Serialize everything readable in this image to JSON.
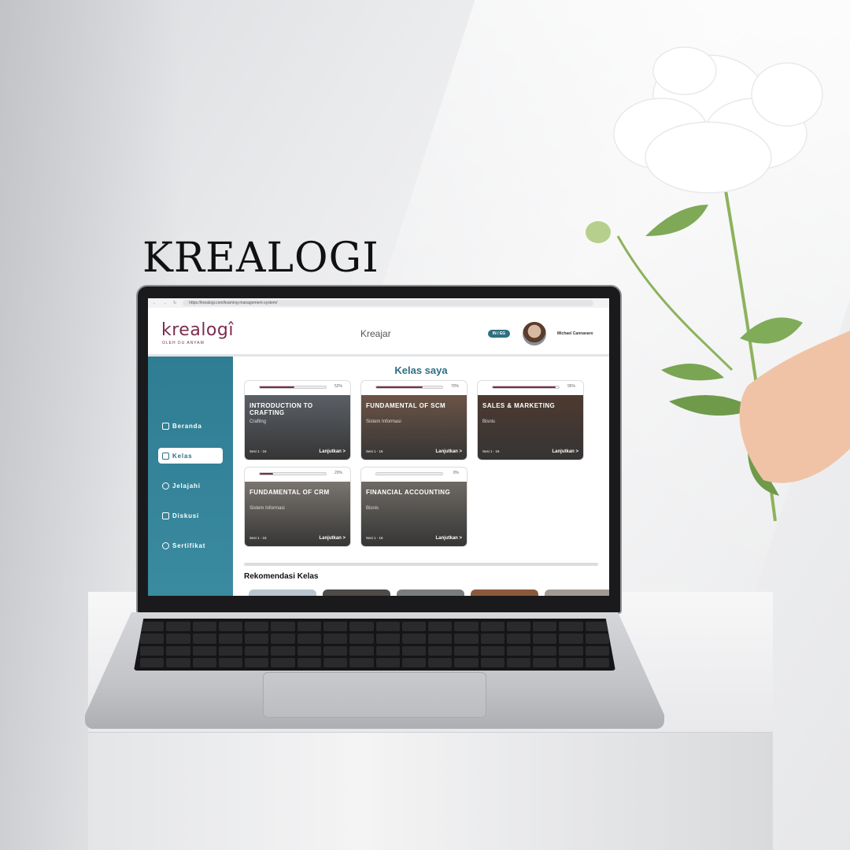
{
  "poster": {
    "brand": "KREALOGI"
  },
  "browser": {
    "url": "https://krealogi.com/learning-management-system/"
  },
  "header": {
    "logo_text": "krealogî",
    "logo_subtitle": "OLEH DU ANYAM",
    "title": "Kreajar",
    "lang_badge": "IN / EG",
    "user_name": "Michael Cannavaro"
  },
  "sidebar": {
    "items": [
      {
        "label": "Beranda",
        "icon": "home-icon"
      },
      {
        "label": "Kelas",
        "icon": "book-icon",
        "active": true
      },
      {
        "label": "Jelajahi",
        "icon": "compass-icon"
      },
      {
        "label": "Diskusi",
        "icon": "chat-icon"
      },
      {
        "label": "Sertifikat",
        "icon": "certificate-icon"
      }
    ]
  },
  "main": {
    "title": "Kelas saya",
    "courses": [
      {
        "title": "INTRODUCTION TO CRAFTING",
        "category": "Crafting",
        "progress": 52,
        "progress_label": "52%",
        "sessions": "Sesi 1 - 16",
        "link": "Lanjutkan >",
        "image_color": "#5b6066"
      },
      {
        "title": "FUNDAMENTAL OF SCM",
        "category": "Sistem Informasi",
        "progress": 70,
        "progress_label": "70%",
        "sessions": "Sesi 1 - 16",
        "link": "Lanjutkan >",
        "image_color": "#6b5446"
      },
      {
        "title": "SALES & MARKETING",
        "category": "Bisnis",
        "progress": 95,
        "progress_label": "95%",
        "sessions": "Sesi 1 - 16",
        "link": "Lanjutkan >",
        "image_color": "#4e3a30"
      },
      {
        "title": "FUNDAMENTAL OF CRM",
        "category": "Sistem Informasi",
        "progress": 20,
        "progress_label": "20%",
        "sessions": "Sesi 1 - 16",
        "link": "Lanjutkan >",
        "image_color": "#7a756f"
      },
      {
        "title": "FINANCIAL ACCOUNTING",
        "category": "Bisnis",
        "progress": 0,
        "progress_label": "0%",
        "sessions": "Sesi 1 - 16",
        "link": "Lanjutkan >",
        "image_color": "#6e6964"
      }
    ],
    "recommendations_title": "Rekomendasi Kelas"
  },
  "colors": {
    "brand_primary": "#7b2d4d",
    "sidebar_teal": "#2f7d92",
    "accent_teal": "#2f6f82"
  }
}
